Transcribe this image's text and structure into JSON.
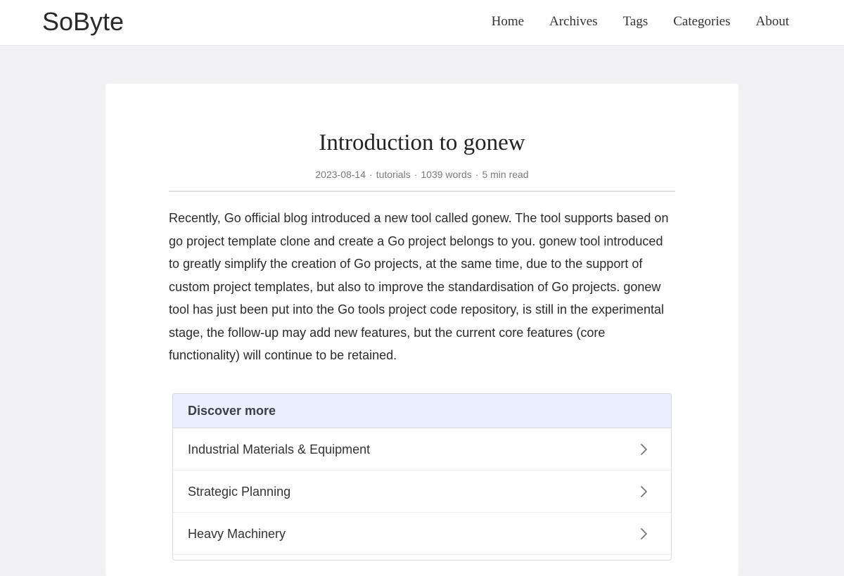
{
  "site": {
    "logo": "SoByte"
  },
  "nav": {
    "items": [
      "Home",
      "Archives",
      "Tags",
      "Categories",
      "About"
    ]
  },
  "post": {
    "title": "Introduction to gonew",
    "date": "2023-08-14",
    "category": "tutorials",
    "words": "1039 words",
    "read_time": "5 min read",
    "separator": "·",
    "body": "Recently, Go official blog introduced a new tool called gonew. The tool supports based on go project template clone and create a Go project belongs to you. gonew tool introduced to greatly simplify the creation of Go projects, at the same time, due to the support of custom project templates, but also to improve the standardisation of Go projects. gonew tool has just been put into the Go tools project code repository, is still in the experimental stage, the follow-up may add new features, but the current core features (core functionality) will continue to be retained."
  },
  "discover": {
    "title": "Discover more",
    "items": [
      {
        "label": "Industrial Materials & Equipment",
        "icon": "chevron-right-icon"
      },
      {
        "label": "Strategic Planning",
        "icon": "chevron-right-icon"
      },
      {
        "label": "Heavy Machinery",
        "icon": "chevron-right-icon"
      }
    ]
  },
  "colors": {
    "page_bg": "#f1f1f4",
    "card_bg": "#ffffff",
    "discover_header_bg": "#e9effc",
    "meta_text": "#7a7a7a"
  }
}
